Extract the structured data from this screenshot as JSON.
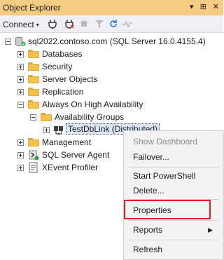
{
  "window": {
    "title": "Object Explorer",
    "title_icons": [
      "pin-icon",
      "auto-hide-icon",
      "close-icon"
    ],
    "title_glyphs": [
      "▾",
      "⊞",
      "✕"
    ]
  },
  "toolbar": {
    "connect_label": "Connect",
    "connect_caret": "▾"
  },
  "tree": {
    "server_label": "sql2022.contoso.com (SQL Server 16.0.4155.4)",
    "nodes": [
      {
        "label": "Databases"
      },
      {
        "label": "Security"
      },
      {
        "label": "Server Objects"
      },
      {
        "label": "Replication"
      },
      {
        "label": "Always On High Availability"
      },
      {
        "label": "Availability Groups"
      },
      {
        "label": "TestDbLink (Distributed)"
      },
      {
        "label": "Management"
      },
      {
        "label": "SQL Server Agent"
      },
      {
        "label": "XEvent Profiler"
      }
    ]
  },
  "context_menu": {
    "items": [
      {
        "label": "Show Dashboard",
        "enabled": false
      },
      {
        "label": "Failover...",
        "enabled": true
      },
      {
        "label": "Start PowerShell",
        "enabled": true
      },
      {
        "label": "Delete...",
        "enabled": true
      },
      {
        "label": "Properties",
        "enabled": true,
        "highlighted": true
      },
      {
        "label": "Reports",
        "enabled": true,
        "submenu_arrow": "▶"
      },
      {
        "label": "Refresh",
        "enabled": true
      }
    ]
  },
  "colors": {
    "title_bar": "#f5cc84",
    "toolbar": "#eef0f6",
    "highlight_box": "#e01f2b",
    "folder": "#f2c14e"
  }
}
